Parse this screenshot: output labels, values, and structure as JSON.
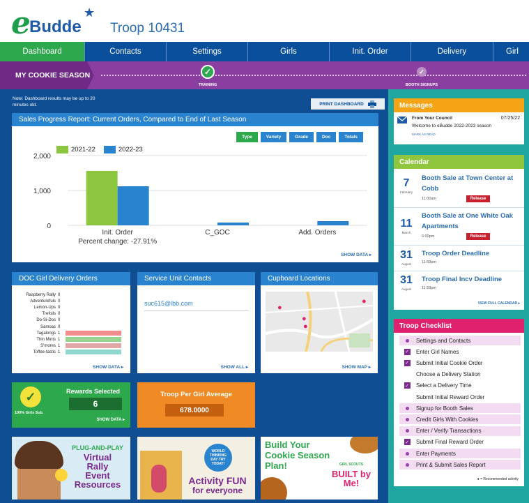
{
  "header": {
    "logo_text": "Budde",
    "logo_letter": "e",
    "troop": "Troop 10431"
  },
  "nav": [
    {
      "label": "Dashboard",
      "active": true
    },
    {
      "label": "Contacts"
    },
    {
      "label": "Settings"
    },
    {
      "label": "Girls"
    },
    {
      "label": "Init. Order"
    },
    {
      "label": "Delivery"
    },
    {
      "label": "Girl"
    }
  ],
  "season": {
    "label": "MY COOKIE SEASON",
    "milestones": [
      {
        "label": "TRAINING",
        "done": true,
        "color": "#2da84d"
      },
      {
        "label": "BOOTH SIGNUPS",
        "done": false,
        "color": "#b98fc4"
      }
    ]
  },
  "note": "Note: Dashboard results may be up to 20 minutes old.",
  "print_label": "PRINT DASHBOARD",
  "sales": {
    "title": "Sales Progress Report: Current Orders, Compared to End of Last Season",
    "filters": [
      "Type",
      "Variety",
      "Grade",
      "Doc",
      "Totals"
    ],
    "active_filter": "Type",
    "percent_change": "Percent change: -27.91%",
    "show_data": "SHOW DATA ▸"
  },
  "chart_data": {
    "type": "bar",
    "categories": [
      "Init. Order",
      "C_GOC",
      "Add. Orders"
    ],
    "series": [
      {
        "name": "2021-22",
        "color": "#8cc63f",
        "values": [
          1560,
          0,
          0
        ]
      },
      {
        "name": "2022-23",
        "color": "#2a83cf",
        "values": [
          1120,
          80,
          120
        ]
      }
    ],
    "yticks": [
      "2,000",
      "1,000",
      "0"
    ],
    "ylim": [
      0,
      2000
    ],
    "grid": true,
    "legend": "top-left"
  },
  "doc_panel": {
    "title": "DOC Girl Delivery Orders",
    "rows": [
      {
        "name": "Raspberry Rally",
        "count": "0",
        "value": 0
      },
      {
        "name": "Adventurefuls",
        "count": "0",
        "value": 0
      },
      {
        "name": "Lemon-Ups",
        "count": "0",
        "value": 0
      },
      {
        "name": "Trefoils",
        "count": "0",
        "value": 0
      },
      {
        "name": "Do-Si-Dos",
        "count": "0",
        "value": 0
      },
      {
        "name": "Samoas",
        "count": "0",
        "value": 0
      },
      {
        "name": "Tagalongs",
        "count": "1",
        "value": 1,
        "color": "#f28b8b"
      },
      {
        "name": "Thin Mints",
        "count": "1",
        "value": 1,
        "color": "#98d48e"
      },
      {
        "name": "S'mores",
        "count": "1",
        "value": 1,
        "color": "#e2a8a8"
      },
      {
        "name": "Toffee-tastic",
        "count": "1",
        "value": 1,
        "color": "#8ed8d0"
      }
    ],
    "show_data": "SHOW DATA ▸"
  },
  "suc_panel": {
    "title": "Service Unit Contacts",
    "email": "suc615@lbb.com",
    "show_all": "SHOW ALL ▸"
  },
  "cup_panel": {
    "title": "Cupboard Locations",
    "show_map": "SHOW MAP ▸"
  },
  "rewards": {
    "title": "Rewards Selected",
    "value": "6",
    "sub": "100% Girls Sub.",
    "show_data": "SHOW DATA ▸"
  },
  "avg": {
    "title": "Troop Per Girl Average",
    "value": "678.0000"
  },
  "promos": [
    {
      "lines": [
        "PLUG-AND-PLAY",
        "Virtual",
        "Rally",
        "Event",
        "Resources"
      ]
    },
    {
      "lines": [
        "Activity FUN",
        "for everyone"
      ],
      "badge": "WORLD THINKING DAY TRY TODAY!"
    },
    {
      "lines": [
        "Build Your",
        "Cookie Season",
        "Plan!"
      ],
      "badge_top": "GIRL SCOUTS",
      "badge": "BUILT by Me!"
    }
  ],
  "messages": {
    "title": "Messages",
    "from": "From Your Council",
    "date": "07/25/22",
    "body": "Welcome to eBudde 2022-2023 season",
    "mark_read": "MARK AS READ"
  },
  "calendar": {
    "title": "Calendar",
    "items": [
      {
        "day": "7",
        "month": "February",
        "title": "Booth Sale at Town Center at Cobb",
        "time": "11:00am",
        "release": "Release"
      },
      {
        "day": "11",
        "month": "March",
        "title": "Booth Sale at One White Oak Apartments",
        "time": "6:00pm",
        "release": "Release"
      },
      {
        "day": "31",
        "month": "August",
        "title": "Troop Order Deadline",
        "time": "11:59pm"
      },
      {
        "day": "31",
        "month": "August",
        "title": "Troop Final Incv Deadline",
        "time": "11:59pm"
      }
    ],
    "view_full": "VIEW FULL CALENDAR ▸"
  },
  "checklist": {
    "title": "Troop Checklist",
    "items": [
      {
        "label": "Settings and Contacts",
        "mark": "dot",
        "rec": true
      },
      {
        "label": "Enter Girl Names",
        "mark": "check",
        "rec": false
      },
      {
        "label": "Submit Initial Cookie Order",
        "mark": "check",
        "rec": false
      },
      {
        "label": "Choose a Delivery Station",
        "mark": "none",
        "rec": false
      },
      {
        "label": "Select a Delivery Time",
        "mark": "check",
        "rec": false
      },
      {
        "label": "Submit Initial Reward Order",
        "mark": "none",
        "rec": false
      },
      {
        "label": "Signup for Booth Sales",
        "mark": "dot",
        "rec": true
      },
      {
        "label": "Credit Girls With Cookies",
        "mark": "dot",
        "rec": true
      },
      {
        "label": "Enter / Verify Transactions",
        "mark": "dot",
        "rec": true
      },
      {
        "label": "Submit Final Reward Order",
        "mark": "check",
        "rec": false
      },
      {
        "label": "Enter Payments",
        "mark": "dot",
        "rec": true
      },
      {
        "label": "Print & Submit Sales Report",
        "mark": "dot",
        "rec": true
      }
    ],
    "footnote": "= Recommended activity"
  }
}
